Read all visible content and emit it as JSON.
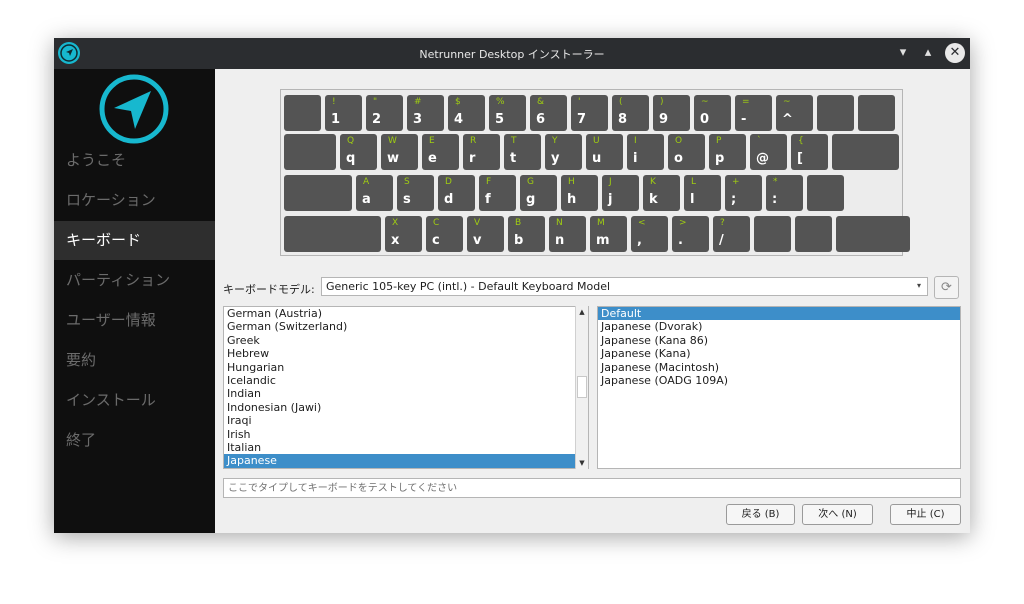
{
  "window": {
    "title": "Netrunner Desktop インストーラー"
  },
  "titlebar_icons": {
    "minimize": "▾",
    "maximize": "▴",
    "close": "✕"
  },
  "sidebar": {
    "items": [
      {
        "label": "ようこそ",
        "active": false
      },
      {
        "label": "ロケーション",
        "active": false
      },
      {
        "label": "キーボード",
        "active": true
      },
      {
        "label": "パーティション",
        "active": false
      },
      {
        "label": "ユーザー情報",
        "active": false
      },
      {
        "label": "要約",
        "active": false
      },
      {
        "label": "インストール",
        "active": false
      },
      {
        "label": "終了",
        "active": false
      }
    ]
  },
  "keyboard": {
    "rows": [
      [
        {
          "top": "",
          "bot": ""
        },
        {
          "top": "!",
          "bot": "1"
        },
        {
          "top": "\"",
          "bot": "2"
        },
        {
          "top": "#",
          "bot": "3"
        },
        {
          "top": "$",
          "bot": "4"
        },
        {
          "top": "%",
          "bot": "5"
        },
        {
          "top": "&",
          "bot": "6"
        },
        {
          "top": "'",
          "bot": "7"
        },
        {
          "top": "(",
          "bot": "8"
        },
        {
          "top": ")",
          "bot": "9"
        },
        {
          "top": "~",
          "bot": "0"
        },
        {
          "top": "=",
          "bot": "-"
        },
        {
          "top": "~",
          "bot": "^"
        },
        {
          "top": "",
          "bot": ""
        },
        {
          "top": "",
          "bot": ""
        }
      ],
      [
        {
          "top": "",
          "bot": ""
        },
        {
          "top": "Q",
          "bot": "q"
        },
        {
          "top": "W",
          "bot": "w"
        },
        {
          "top": "E",
          "bot": "e"
        },
        {
          "top": "R",
          "bot": "r"
        },
        {
          "top": "T",
          "bot": "t"
        },
        {
          "top": "Y",
          "bot": "y"
        },
        {
          "top": "U",
          "bot": "u"
        },
        {
          "top": "I",
          "bot": "i"
        },
        {
          "top": "O",
          "bot": "o"
        },
        {
          "top": "P",
          "bot": "p"
        },
        {
          "top": "`",
          "bot": "@"
        },
        {
          "top": "{",
          "bot": "["
        },
        {
          "top": "",
          "bot": ""
        }
      ],
      [
        {
          "top": "",
          "bot": ""
        },
        {
          "top": "A",
          "bot": "a"
        },
        {
          "top": "S",
          "bot": "s"
        },
        {
          "top": "D",
          "bot": "d"
        },
        {
          "top": "F",
          "bot": "f"
        },
        {
          "top": "G",
          "bot": "g"
        },
        {
          "top": "H",
          "bot": "h"
        },
        {
          "top": "J",
          "bot": "j"
        },
        {
          "top": "K",
          "bot": "k"
        },
        {
          "top": "L",
          "bot": "l"
        },
        {
          "top": "+",
          "bot": ";"
        },
        {
          "top": "*",
          "bot": ":"
        },
        {
          "top": "",
          "bot": ""
        }
      ],
      [
        {
          "top": "",
          "bot": ""
        },
        {
          "top": "X",
          "bot": "x"
        },
        {
          "top": "C",
          "bot": "c"
        },
        {
          "top": "V",
          "bot": "v"
        },
        {
          "top": "B",
          "bot": "b"
        },
        {
          "top": "N",
          "bot": "n"
        },
        {
          "top": "M",
          "bot": "m"
        },
        {
          "top": "<",
          "bot": ","
        },
        {
          "top": ">",
          "bot": "."
        },
        {
          "top": "?",
          "bot": "/"
        },
        {
          "top": "",
          "bot": ""
        },
        {
          "top": "",
          "bot": ""
        },
        {
          "top": "",
          "bot": ""
        }
      ]
    ]
  },
  "keyboard_model": {
    "label": "キーボードモデル:",
    "value": "Generic 105-key PC (intl.)  -  Default Keyboard Model",
    "dropdown_icon": "▾",
    "reset_icon": "⟳"
  },
  "layouts": {
    "items": [
      "German (Austria)",
      "German (Switzerland)",
      "Greek",
      "Hebrew",
      "Hungarian",
      "Icelandic",
      "Indian",
      "Indonesian (Jawi)",
      "Iraqi",
      "Irish",
      "Italian",
      "Japanese"
    ],
    "selected": "Japanese",
    "scroll_up_icon": "▲",
    "scroll_down_icon": "▼"
  },
  "variants": {
    "items": [
      "Default",
      "Japanese (Dvorak)",
      "Japanese (Kana 86)",
      "Japanese (Kana)",
      "Japanese (Macintosh)",
      "Japanese (OADG 109A)"
    ],
    "selected": "Default"
  },
  "test_field": {
    "placeholder": "ここでタイプしてキーボードをテストしてください",
    "value": ""
  },
  "buttons": {
    "back": "戻る (B)",
    "next": "次へ (N)",
    "cancel": "中止 (C)"
  },
  "colors": {
    "accent": "#17b8cf",
    "selection": "#3d8ec9",
    "key_letter": "#9fcc12"
  }
}
